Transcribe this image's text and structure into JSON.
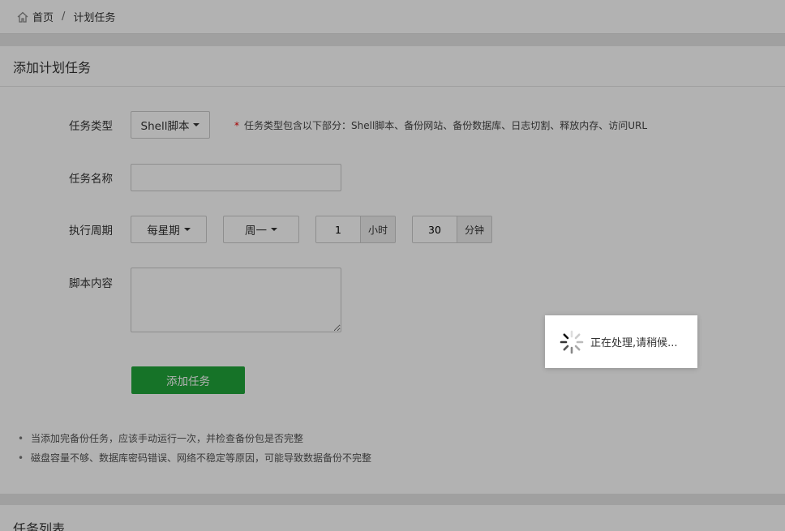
{
  "breadcrumb": {
    "home_label": "首页",
    "separator": "/",
    "current": "计划任务"
  },
  "form_panel": {
    "title": "添加计划任务",
    "task_type": {
      "label": "任务类型",
      "value": "Shell脚本",
      "hint_star": "*",
      "hint": "任务类型包含以下部分：Shell脚本、备份网站、备份数据库、日志切割、释放内存、访问URL"
    },
    "task_name": {
      "label": "任务名称",
      "value": ""
    },
    "cycle": {
      "label": "执行周期",
      "period": "每星期",
      "weekday": "周一",
      "hour_value": "1",
      "hour_unit": "小时",
      "minute_value": "30",
      "minute_unit": "分钟"
    },
    "script": {
      "label": "脚本内容",
      "value": ""
    },
    "submit_label": "添加任务",
    "tips": [
      "当添加完备份任务，应该手动运行一次，并检查备份包是否完整",
      "磁盘容量不够、数据库密码错误、网络不稳定等原因，可能导致数据备份不完整"
    ]
  },
  "list_panel": {
    "title": "任务列表"
  },
  "loading": {
    "text": "正在处理,请稍候..."
  },
  "colors": {
    "accent_green": "#20a53a",
    "required_star": "#e00000",
    "overlay": "rgba(0,0,0,0.3)"
  },
  "icons": {
    "home": "home-icon",
    "spinner": "loading-spinner-icon"
  }
}
